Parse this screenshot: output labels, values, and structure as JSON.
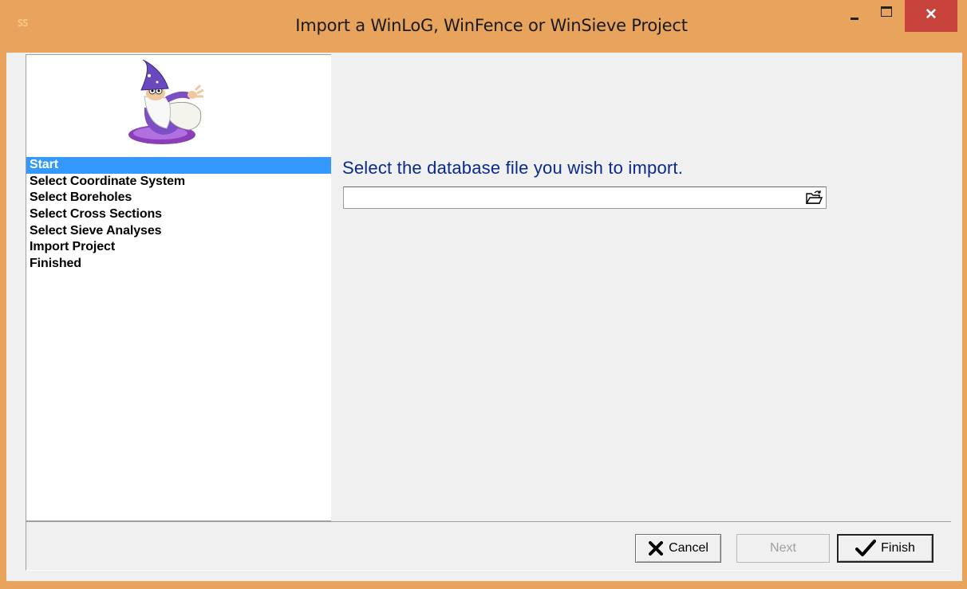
{
  "window": {
    "title": "Import a WinLoG, WinFence or WinSieve Project",
    "app_icon_text": "SS",
    "close_glyph": "✕"
  },
  "sidebar": {
    "steps": [
      {
        "label": "Start",
        "active": true
      },
      {
        "label": "Select Coordinate System",
        "active": false
      },
      {
        "label": "Select Boreholes",
        "active": false
      },
      {
        "label": "Select Cross Sections",
        "active": false
      },
      {
        "label": "Select Sieve Analyses",
        "active": false
      },
      {
        "label": "Import Project",
        "active": false
      },
      {
        "label": "Finished",
        "active": false
      }
    ],
    "image_icon": "wizard-mascot-icon"
  },
  "main": {
    "prompt": "Select the database file you wish to import.",
    "file_path_value": "",
    "browse_icon": "open-folder-icon"
  },
  "footer": {
    "cancel_label": "Cancel",
    "next_label": "Next",
    "finish_label": "Finish"
  },
  "colors": {
    "title_bar": "#e8a35c",
    "close_button": "#c7423b",
    "active_step": "#3399ff",
    "prompt_text": "#0a2a8a"
  }
}
